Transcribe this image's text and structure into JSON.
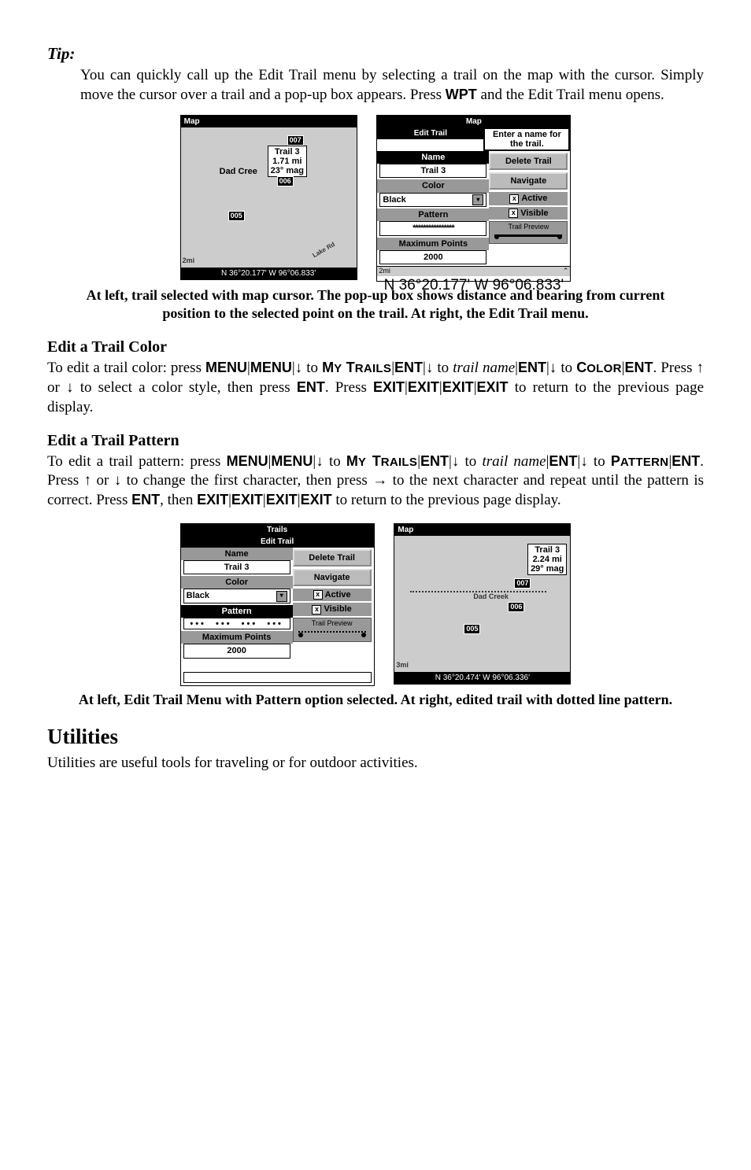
{
  "tip": {
    "heading": "Tip:",
    "body_pre": "You can quickly call up the Edit Trail menu by selecting a trail on the map with the cursor. Simply move the cursor over a trail and a pop-up box appears. Press ",
    "body_key": "WPT",
    "body_post": " and the Edit Trail menu opens."
  },
  "fig1": {
    "left": {
      "title": "Map",
      "popup_line1": "Trail 3",
      "popup_line2": "1.71 mi",
      "popup_line3": "23° mag",
      "label_dadcreek": "Dad Cree",
      "wp_a": "007",
      "wp_b": "006",
      "wp_c": "005",
      "lake_rd": "Lake Rd",
      "scale": "2mi",
      "status": "N  36°20.177'  W  96°06.833'"
    },
    "right": {
      "title": "Map",
      "hint": "Enter a name for the trail.",
      "overlay_title": "Edit Trail",
      "name_label": "Name",
      "name_value": "Trail 3",
      "color_label": "Color",
      "color_value": "Black",
      "pattern_label": "Pattern",
      "pattern_value": "****************",
      "maxpts_label": "Maximum Points",
      "maxpts_value": "2000",
      "btn_delete": "Delete Trail",
      "btn_navigate": "Navigate",
      "chk_active": "Active",
      "chk_visible": "Visible",
      "preview_label": "Trail Preview",
      "scale": "2mi",
      "status": "N  36°20.177'  W  96°06.833'"
    },
    "caption": "At left, trail selected with map cursor. The pop-up box shows distance and bearing from current position to the selected point on the trail. At right, the Edit Trail menu."
  },
  "editColor": {
    "heading": "Edit a Trail Color",
    "text": {
      "p1": "To edit a trail color: press ",
      "p2": " to ",
      "p3": " to ",
      "p4": ". Press ",
      "p5": " or ",
      "p6": " to select a color style, then press ",
      "p7": ". Press ",
      "p8": " to return to the previous page display."
    },
    "keys": {
      "menu": "MENU",
      "mytrails_a": "M",
      "mytrails_b": "Y",
      "mytrails_c": " T",
      "mytrails_d": "RAILS",
      "ent": "ENT",
      "color_a": "C",
      "color_b": "OLOR",
      "exit": "EXIT"
    },
    "trail_name": "trail name"
  },
  "editPattern": {
    "heading": "Edit a Trail Pattern",
    "text": {
      "p1": "To edit a trail pattern: press ",
      "p2": " to ",
      "p3": " to ",
      "p4": ". Press ",
      "p5": " or ",
      "p6": " to change the first character, then press ",
      "p7": " to the next character and repeat until the pattern is correct. Press ",
      "p8": ", then ",
      "p9": " to return to the previous page display."
    },
    "keys": {
      "menu": "MENU",
      "ent": "ENT",
      "exit": "EXIT",
      "pattern_a": "P",
      "pattern_b": "ATTERN"
    },
    "trail_name": "trail name"
  },
  "fig2": {
    "left": {
      "title": "Trails",
      "overlay_title": "Edit Trail",
      "name_label": "Name",
      "name_value": "Trail 3",
      "color_label": "Color",
      "color_value": "Black",
      "pattern_label": "Pattern",
      "maxpts_label": "Maximum Points",
      "maxpts_value": "2000",
      "btn_delete": "Delete Trail",
      "btn_navigate": "Navigate",
      "chk_active": "Active",
      "chk_visible": "Visible",
      "preview_label": "Trail Preview"
    },
    "right": {
      "title": "Map",
      "popup_line1": "Trail 3",
      "popup_line2": "2.24 mi",
      "popup_line3": "29° mag",
      "label_dadcreek": "Dad Creek",
      "wp_a": "007",
      "wp_b": "006",
      "wp_c": "005",
      "scale": "3mi",
      "status": "N  36°20.474'  W  96°06.336'"
    },
    "caption": "At left, Edit Trail Menu with Pattern option selected. At right, edited trail with dotted line pattern."
  },
  "utilities": {
    "heading": "Utilities",
    "body": "Utilities are useful tools for traveling or for outdoor activities."
  }
}
